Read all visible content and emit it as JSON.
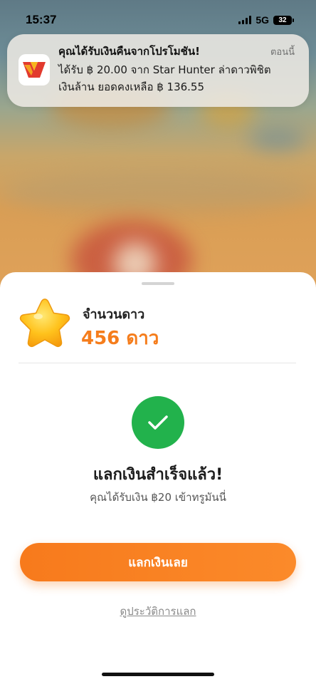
{
  "status_bar": {
    "time": "15:37",
    "network": "5G",
    "battery": "32"
  },
  "notification": {
    "app_icon": "wallet-logo-icon",
    "title": "คุณได้รับเงินคืนจากโปรโมชัน!",
    "timestamp": "ตอนนี้",
    "body_line1": "ได้รับ ฿ 20.00 จาก Star Hunter ล่าดาวพิชิต",
    "body_line2": "เงินล้าน ยอดคงเหลือ ฿ 136.55"
  },
  "sheet": {
    "star_icon": "star-icon",
    "stars_label": "จำนวนดาว",
    "stars_count": "456 ดาว",
    "success_icon": "check-icon",
    "success_title": "แลกเงินสำเร็จแล้ว!",
    "success_subtitle": "คุณได้รับเงิน ฿20 เข้าทรูมันนี่",
    "redeem_button": "แลกเงินเลย",
    "history_link": "ดูประวัติการแลก"
  },
  "colors": {
    "accent_orange": "#f57d1c",
    "success_green": "#22b24c",
    "button_gradient_start": "#f77a1c",
    "button_gradient_end": "#fb8a2a"
  }
}
